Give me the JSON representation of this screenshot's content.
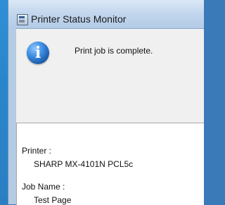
{
  "window": {
    "title": "Printer Status Monitor"
  },
  "dialog": {
    "message": "Print job is complete.",
    "icon": "info-icon",
    "details": {
      "printer_label": "Printer :",
      "printer_value": "SHARP MX-4101N PCL5c",
      "job_label": "Job Name :",
      "job_value": "Test Page"
    }
  },
  "colors": {
    "icon_blue": "#3d8fe3",
    "window_frame": "#b9d0e8",
    "client_bg": "#f0f0f0"
  }
}
